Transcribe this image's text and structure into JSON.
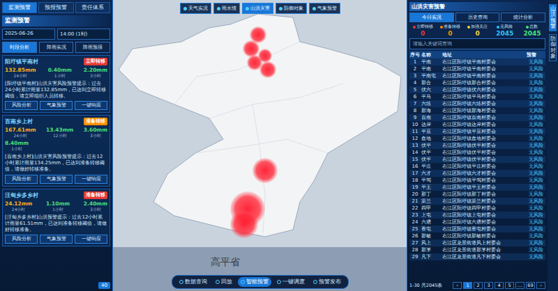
{
  "left_panel": {
    "tabs": [
      {
        "label": "监测预警",
        "selected": true
      },
      {
        "label": "预报预警",
        "selected": false
      },
      {
        "label": "责任体系",
        "selected": false
      }
    ],
    "title": "监测预警",
    "date": "2025-06-26",
    "time": "14:00 (1时)",
    "filters": [
      {
        "label": "时段分析",
        "selected": true
      },
      {
        "label": "降雨实况",
        "selected": false
      },
      {
        "label": "降雨预报",
        "selected": false
      }
    ],
    "alerts": [
      {
        "name": "阳圩镇平南村",
        "badge": "立即转移",
        "color": "#e53935",
        "readings": [
          "132.85mm",
          "0.40mm",
          "2.20mm"
        ],
        "captions": [
          "24小时",
          "1小时",
          "3小时"
        ],
        "text": "[阳圩镇平南村]山洪灾害风险预警提示：过去24小时累计雨量132.85mm，已达到立即转移阈值，请立即组织人员转移。",
        "buttons": [
          "风险分析",
          "气象预警",
          "一键响应"
        ]
      },
      {
        "name": "百南乡上村",
        "badge": "准备转移",
        "color": "#ff8f00",
        "readings": [
          "167.61mm",
          "13.43mm",
          "3.60mm",
          "8.40mm"
        ],
        "captions": [
          "24小时",
          "12小时",
          "3小时",
          "1小时"
        ],
        "text": "[百南乡上村]山洪灾害风险预警提示：过去12小时累计雨量134.25mm，已达到准备转移阈值，请做好转移准备。",
        "buttons": [
          "风险分析",
          "气象预警",
          "一键响应"
        ]
      },
      {
        "name": "汪甸乡多乡村",
        "badge": "准备转移",
        "color": "#e53935",
        "readings": [
          "24.12mm",
          "1.10mm",
          "2.40mm"
        ],
        "captions": [
          "24小时",
          "1小时",
          "3小时"
        ],
        "text": "[汪甸乡多乡村]山洪预警提示：过去12小时累计雨量61.51mm，已达到准备转移阈值，请做好转移准备。",
        "buttons": [
          "风险分析",
          "气象预警",
          "一键响应"
        ]
      }
    ],
    "footer": "40"
  },
  "map": {
    "toolbar": [
      {
        "label": "天气实况",
        "selected": false
      },
      {
        "label": "雨水情",
        "selected": false
      },
      {
        "label": "山洪灾害",
        "selected": true
      },
      {
        "label": "防御对象",
        "selected": false
      },
      {
        "label": "气象预警",
        "selected": false
      }
    ],
    "label": "高平省",
    "bottom_bar": [
      {
        "label": "数据查询",
        "selected": false
      },
      {
        "label": "回放",
        "selected": false
      },
      {
        "label": "智能预警",
        "selected": true
      },
      {
        "label": "一键调度",
        "selected": false
      },
      {
        "label": "预警发布",
        "selected": false
      }
    ]
  },
  "right_panel": {
    "title": "山洪灾害预警",
    "tabs": [
      {
        "label": "今日实况",
        "selected": true
      },
      {
        "label": "历史查询",
        "selected": false
      },
      {
        "label": "统计分析",
        "selected": false
      }
    ],
    "stats": [
      {
        "label": "立即转移",
        "count": "0",
        "color": "#e53935"
      },
      {
        "label": "准备转移",
        "count": "0",
        "color": "#ff8f00"
      },
      {
        "label": "加强关注",
        "count": "0",
        "color": "#f4d03f"
      },
      {
        "label": "无风险",
        "count": "2045",
        "color": "#2ec4ff"
      },
      {
        "label": "总数",
        "count": "2045",
        "color": "#4be07a"
      }
    ],
    "search": {
      "placeholder": "请输入关键词查询"
    },
    "table": {
      "columns": [
        "序号",
        "名称",
        "地址",
        "预警"
      ],
      "rows": [
        [
          "1",
          "平南",
          "右江区阳圩镇平南村委会",
          "无风险"
        ],
        [
          "2",
          "平南",
          "右江区阳圩镇平南村委会",
          "无风险"
        ],
        [
          "3",
          "平南屯",
          "右江区阳圩镇平南村委会",
          "无风险"
        ],
        [
          "4",
          "那合",
          "右江区阳圩镇那合村委会",
          "无风险"
        ],
        [
          "5",
          "伏六",
          "右江区阳圩镇伏六村委会",
          "无风险"
        ],
        [
          "6",
          "平马",
          "右江区阳圩镇平马村委会",
          "无风险"
        ],
        [
          "7",
          "六练",
          "右江区阳圩镇六练村委会",
          "无风险"
        ],
        [
          "8",
          "那海",
          "右江区阳圩镇那海村委会",
          "无风险"
        ],
        [
          "9",
          "百南",
          "右江区阳圩镇百南村委会",
          "无风险"
        ],
        [
          "10",
          "达岸",
          "右江区阳圩镇达岸村委会",
          "无风险"
        ],
        [
          "11",
          "平豆",
          "右江区阳圩镇平豆村委会",
          "无风险"
        ],
        [
          "12",
          "盘地",
          "右江区阳圩镇盘地村委会",
          "无风险"
        ],
        [
          "13",
          "伏平",
          "右江区阳圩镇伏平村委会",
          "无风险"
        ],
        [
          "14",
          "伏平",
          "右江区阳圩镇伏平村委会",
          "无风险"
        ],
        [
          "15",
          "伏平",
          "右江区阳圩镇伏平村委会",
          "无风险"
        ],
        [
          "16",
          "平庄",
          "右江区阳圩镇平庄村委会",
          "无风险"
        ],
        [
          "17",
          "六才",
          "右江区阳圩镇六才村委会",
          "无风险"
        ],
        [
          "18",
          "平驾",
          "右江区阳圩镇平驾村委会",
          "无风险"
        ],
        [
          "19",
          "平王",
          "右江区阳圩镇平王村委会",
          "无风险"
        ],
        [
          "20",
          "那丁",
          "右江区阳圩镇那丁村委会",
          "无风险"
        ],
        [
          "21",
          "渠兰",
          "右江区阳圩镇渠兰村委会",
          "无风险"
        ],
        [
          "22",
          "四甲",
          "右江区阳圩镇四甲村委会",
          "无风险"
        ],
        [
          "23",
          "上屯",
          "右江区阳圩镇上屯村委会",
          "无风险"
        ],
        [
          "24",
          "六塘",
          "右江区阳圩镇六塘村委会",
          "无风险"
        ],
        [
          "25",
          "香屯",
          "右江区阳圩镇香屯村委会",
          "无风险"
        ],
        [
          "26",
          "那敏",
          "右江区阳圩镇那敏村委会",
          "无风险"
        ],
        [
          "27",
          "风上",
          "右江区龙景街道风上村委会",
          "无风险"
        ],
        [
          "28",
          "那茅",
          "右江区龙景街道那茅村委会",
          "无风险"
        ],
        [
          "29",
          "凡下",
          "右江区龙景街道凡下村委会",
          "无风险"
        ]
      ]
    },
    "pagination": {
      "summary": "1-30 共2045条",
      "prev": "‹",
      "next": "›",
      "pages": [
        {
          "label": "1",
          "selected": true
        },
        {
          "label": "2",
          "selected": false
        },
        {
          "label": "3",
          "selected": false
        },
        {
          "label": "4",
          "selected": false
        },
        {
          "label": "5",
          "selected": false
        },
        {
          "label": "…",
          "selected": false
        },
        {
          "label": "69",
          "selected": false
        }
      ]
    }
  },
  "side_tabs": [
    {
      "label": "山洪预警",
      "selected": true
    },
    {
      "label": "防御对象",
      "selected": false
    }
  ]
}
